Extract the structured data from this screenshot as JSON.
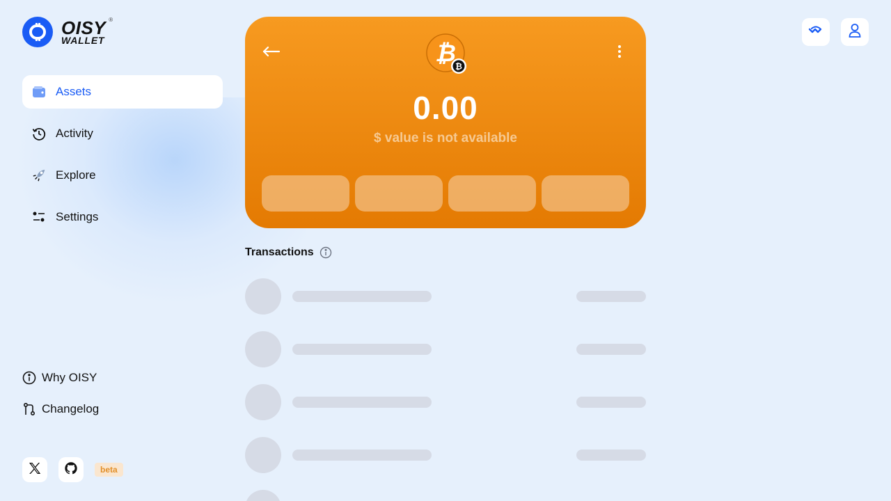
{
  "logo": {
    "line1": "OISY",
    "line2": "WALLET",
    "mark": "®"
  },
  "sidebar": {
    "items": [
      {
        "label": "Assets",
        "icon": "wallet-icon",
        "active": true
      },
      {
        "label": "Activity",
        "icon": "history-icon",
        "active": false
      },
      {
        "label": "Explore",
        "icon": "rocket-icon",
        "active": false
      },
      {
        "label": "Settings",
        "icon": "sliders-icon",
        "active": false
      }
    ],
    "footer": [
      {
        "label": "Why OISY",
        "icon": "info-icon"
      },
      {
        "label": "Changelog",
        "icon": "git-branch-icon"
      }
    ],
    "social": [
      {
        "icon": "x-twitter-icon"
      },
      {
        "icon": "github-icon"
      }
    ],
    "beta_label": "beta"
  },
  "header": {
    "buttons": [
      {
        "icon": "walletconnect-icon"
      },
      {
        "icon": "user-icon"
      }
    ]
  },
  "token_card": {
    "token": "Bitcoin",
    "balance": "0.00",
    "usd_value_text": "$ value is not available",
    "colors": {
      "gradient_top": "#f79a20",
      "gradient_bottom": "#e47a02"
    }
  },
  "transactions": {
    "title": "Transactions",
    "loading_rows": 5
  },
  "colors": {
    "accent": "#1a5cf5",
    "background": "#e6f0fc",
    "skeleton": "#d6dbe6",
    "beta_text": "#e2902a"
  }
}
